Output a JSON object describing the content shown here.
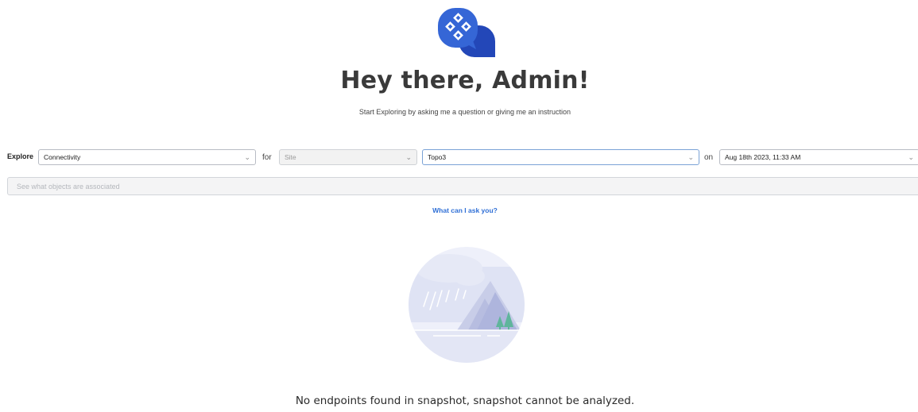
{
  "header": {
    "greeting": "Hey there, Admin!",
    "subtitle": "Start Exploring by asking me a question or giving me an instruction"
  },
  "explore": {
    "explore_label": "Explore",
    "explore_value": "Connectivity",
    "for_label": "for",
    "scope_placeholder": "Site",
    "target_value": "Topo3",
    "on_label": "on",
    "date_value": "Aug 18th 2023, 11:33 AM"
  },
  "query": {
    "placeholder": "See what objects are associated"
  },
  "help": {
    "link_text": "What can I ask you?"
  },
  "empty_state": {
    "message": "No endpoints found in snapshot, snapshot cannot be analyzed."
  },
  "icons": {
    "logo": "chat-bubbles-logo-icon",
    "chevron": "chevron-down-icon",
    "illustration": "rainy-mountain-illustration"
  },
  "colors": {
    "brand_blue": "#3566d6",
    "brand_dark_blue": "#2347b8",
    "link_blue": "#2f6fd6"
  }
}
